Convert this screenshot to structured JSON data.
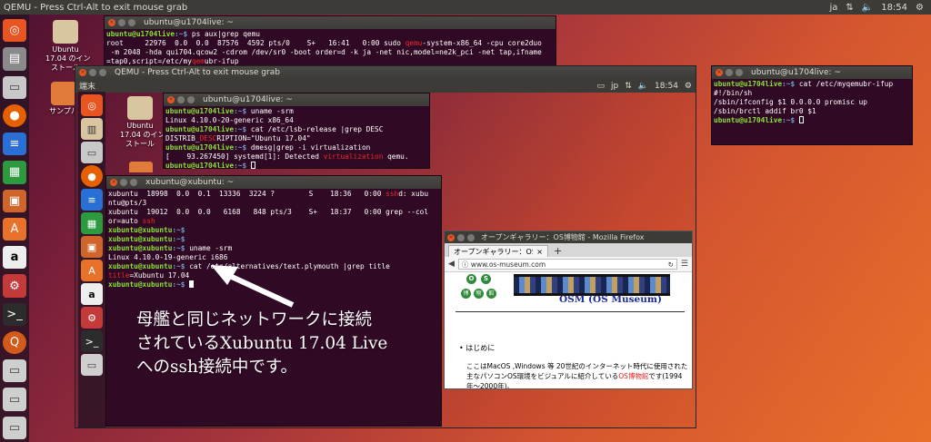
{
  "top_panel": {
    "title": "QEMU - Press Ctrl-Alt to exit mouse grab",
    "keyboard": "ja",
    "time": "18:54"
  },
  "desktop_icons": [
    {
      "label": "Ubuntu\n17.04 のイン\nストール"
    },
    {
      "label": "サンプル"
    }
  ],
  "outer_launcher": [
    "ubuntu-logo-icon",
    "files-icon",
    "drive-icon",
    "firefox-icon",
    "writer-icon",
    "calc-icon",
    "impress-icon",
    "software-center-icon",
    "amazon-icon",
    "settings-icon",
    "terminal-icon",
    "qemu-icon",
    "drive-icon",
    "drive-icon",
    "drive-icon"
  ],
  "term_host": {
    "title": "ubuntu@u1704live: ~",
    "lines": [
      {
        "p": "ubuntu@u1704live",
        "s": ":~$ ",
        "t": "ps aux|grep qemu"
      },
      {
        "t": "root     22976  0.0  0.0  87576  4592 pts/0    S+   16:41   0:00 sudo "
      },
      {
        "t": " -m 2048 -hda qui704.qcow2 -cdrom /dev/sr0 -boot order=d -k ja -net nic,model=ne2k_pci -net tap,ifname"
      },
      {
        "t": "=tap0,script=/etc/my"
      }
    ],
    "qemu_hl": "qemu",
    "line2_rest": "-system-x86_64 -cpu core2duo",
    "line4_hl": "qem",
    "line4_rest": "ubr-ifup"
  },
  "term_right": {
    "title": "ubuntu@u1704live: ~",
    "prompt": "ubuntu@u1704live",
    "cmd": "cat /etc/myqemubr-ifup",
    "lines": [
      "#!/bin/sh",
      "/sbin/ifconfig $1 0.0.0.0 promisc up",
      "/sbin/brctl addif br0 $1"
    ]
  },
  "qemu_window": {
    "title": "QEMU - Press Ctrl-Alt to exit mouse grab",
    "panel_label": "端末",
    "panel_kb": "jp",
    "panel_time": "18:54",
    "desktop_icon": "Ubuntu\n17.04 のイン\nストール"
  },
  "term_guest": {
    "title": "ubuntu@u1704live: ~",
    "prompt": "ubuntu@u1704live",
    "l1_cmd": "uname -srm",
    "l2": "Linux 4.10.0-20-generic x86_64",
    "l3_cmd": "cat /etc/lsb-release |grep DESC",
    "l4_a": "DISTRIB_",
    "l4_hl": "DESC",
    "l4_b": "RIPTION=\"Ubuntu 17.04\"",
    "l5_cmd": "dmesg|grep -i virtualization",
    "l6_a": "[    93.267450] systemd[1]: Detected ",
    "l6_hl": "virtualization",
    "l6_b": " qemu."
  },
  "term_xubuntu": {
    "title": "xubuntu@xubuntu: ~",
    "l1_a": "xubuntu  18998  0.0  0.1  13336  3224 ?        S    18:36   0:00 ",
    "l1_hl": "ssh",
    "l1_b": "d: xubu",
    "l2": "ntu@pts/3",
    "l3": "xubuntu  19012  0.0  0.0   6168   848 pts/3    S+   18:37   0:00 grep --col",
    "l4_a": "or=auto ",
    "l4_hl": "ssh",
    "prompt": "xubuntu@xubuntu",
    "cmd_uname": "uname -srm",
    "uname_out": "Linux 4.10.0-19-generic i686",
    "cmd_cat": "cat /etc/alternatives/text.plymouth |grep title",
    "title_hl": "title",
    "title_rest": "=Xubuntu 17.04"
  },
  "firefox": {
    "title": "オープンギャラリー：OS博物館 - Mozilla Firefox",
    "tab": "オープンギャラリー：OS博物館",
    "url": "www.os-museum.com",
    "logo_o": "O",
    "logo_s": "S",
    "logo_k1": "博",
    "logo_k2": "物",
    "logo_k3": "館",
    "site_title": "OSM (OS Museum)",
    "bullet": "はじめに",
    "para_a": "ここはMacOS ,Windows 等 20世紀のインターネット時代に使用された主なパソコンOS環境をビジュアルに紹介している",
    "para_red": "OS博物館",
    "para_b": "です(1994年〜2000年)。"
  },
  "annotation": {
    "line1": "母艦と同じネットワークに接続",
    "line2": "されているXubuntu 17.04 Live",
    "line3": "へのssh接続中です。"
  }
}
